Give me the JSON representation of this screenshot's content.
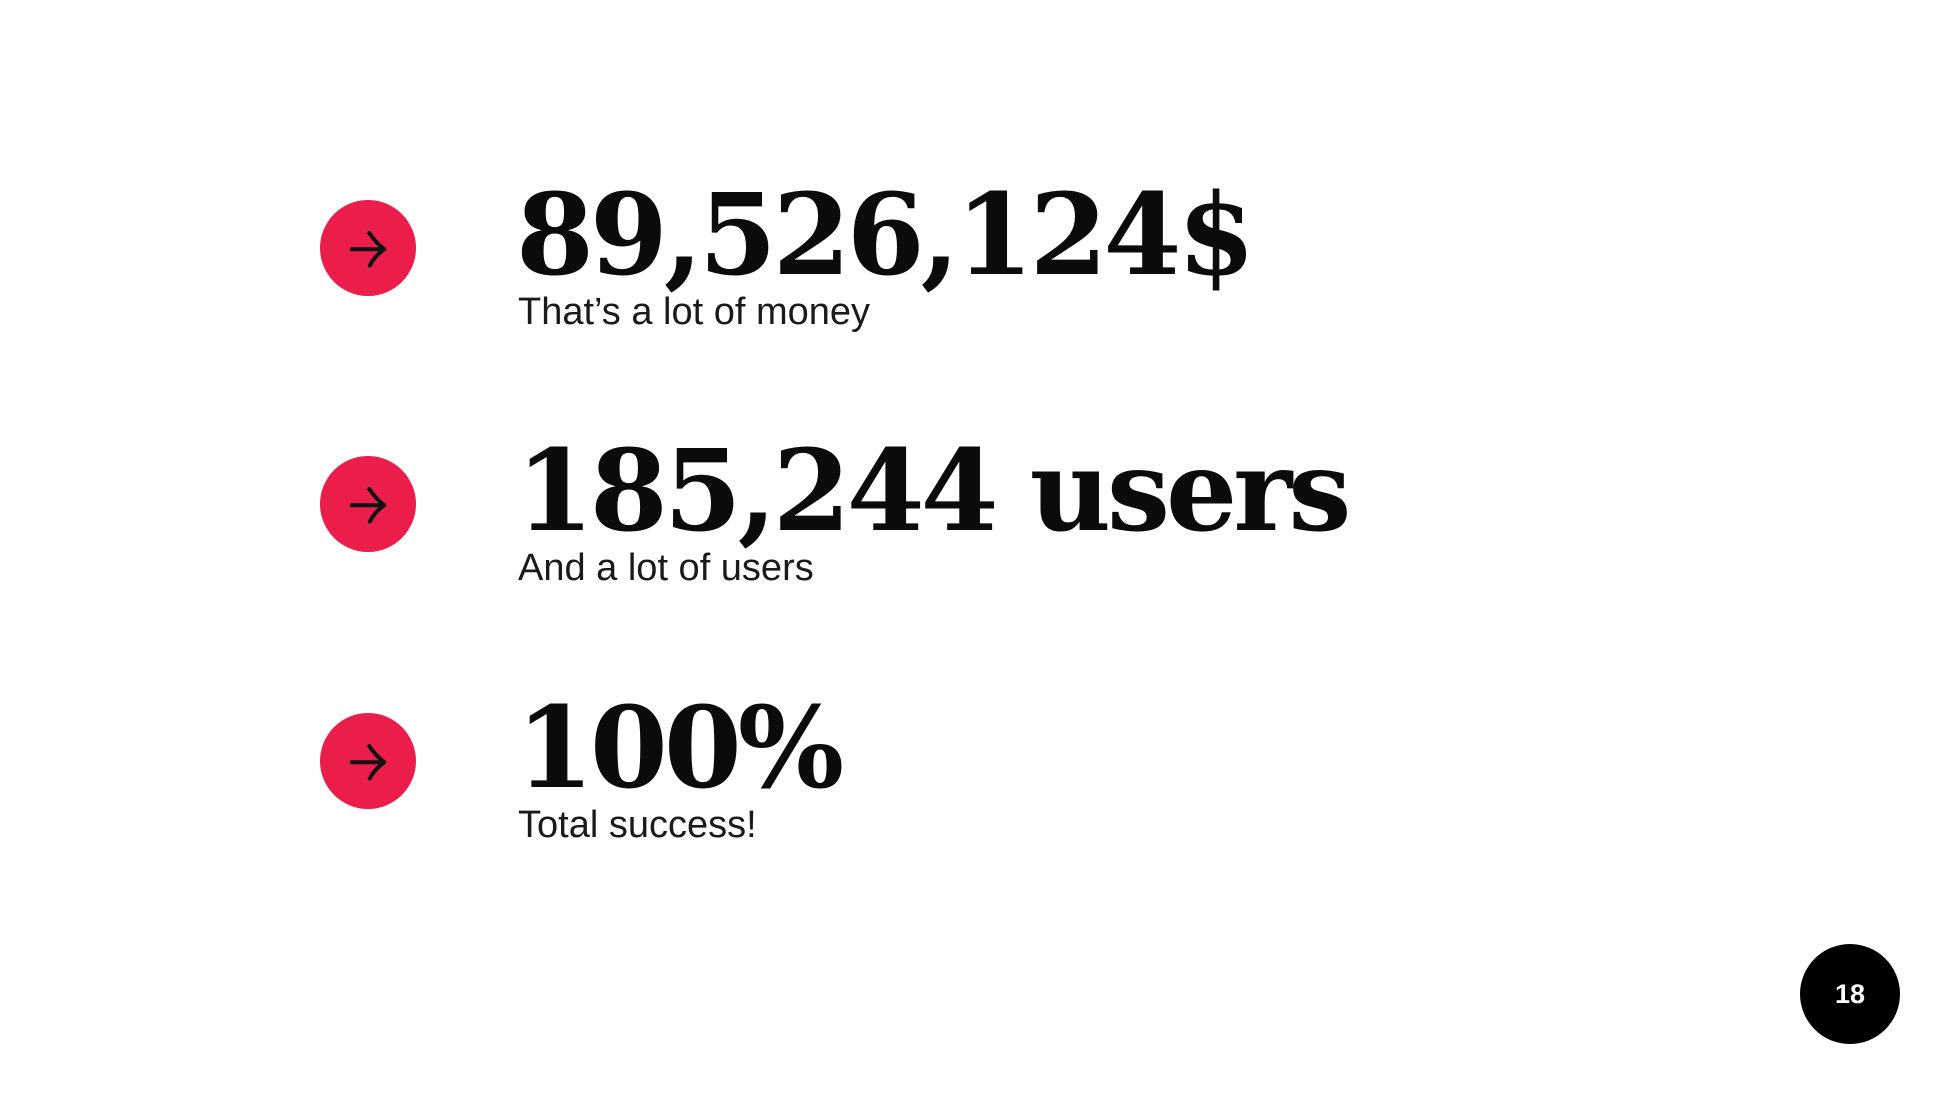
{
  "colors": {
    "accent": "#EB1E4B",
    "text": "#0B0B0B",
    "page_badge": "#000000"
  },
  "stats": [
    {
      "icon": "arrow-right-icon",
      "value": "89,526,124$",
      "caption": "That’s a lot of money"
    },
    {
      "icon": "arrow-right-icon",
      "value": "185,244 users",
      "caption": "And a lot of users"
    },
    {
      "icon": "arrow-right-icon",
      "value": "100%",
      "caption": "Total success!"
    }
  ],
  "page_number": "18"
}
